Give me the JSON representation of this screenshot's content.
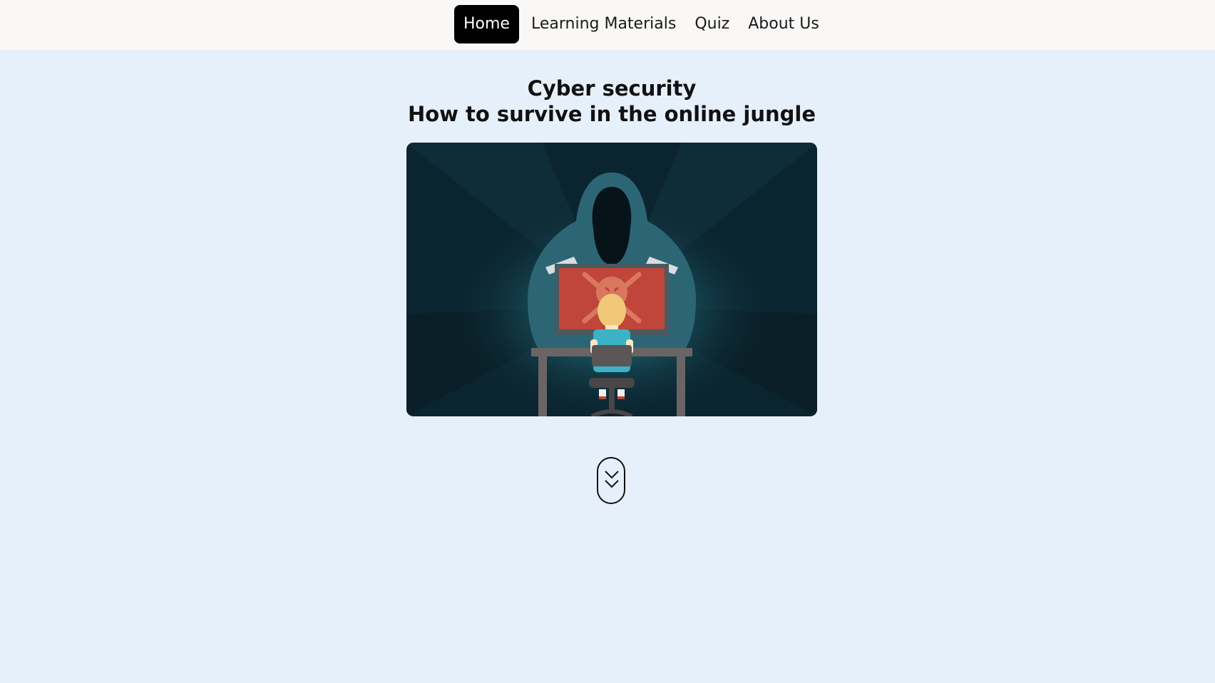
{
  "nav": {
    "items": [
      {
        "label": "Home",
        "active": true
      },
      {
        "label": "Learning Materials",
        "active": false
      },
      {
        "label": "Quiz",
        "active": false
      },
      {
        "label": "About Us",
        "active": false
      }
    ]
  },
  "hero": {
    "title_line1": "Cyber security",
    "title_line2": "How to survive in the online jungle",
    "image_subject": "hooded-hacker-looming-over-child-at-computer"
  },
  "scroll_down": {
    "icon": "double-chevron-down-icon"
  },
  "colors": {
    "background": "#e6f0fa",
    "navbar": "#f9f8f6",
    "active_tab": "#000000",
    "image_bg": "#0b2530",
    "screen_red": "#c0453a"
  }
}
